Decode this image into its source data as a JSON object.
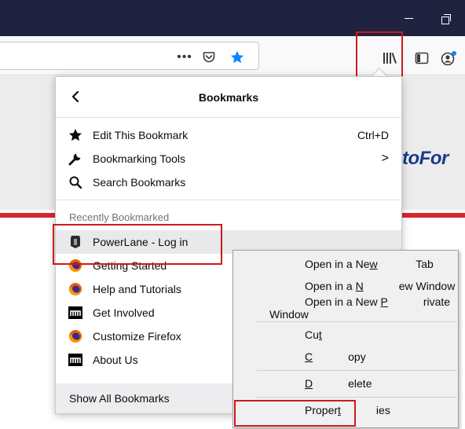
{
  "toolbar": {
    "page_actions_icon": "meatball-menu-icon",
    "page_actions_glyph": "•••",
    "pocket_icon": "pocket-icon",
    "bookmark_star_icon": "bookmark-star-icon",
    "library_icon": "library-icon",
    "sidebar_icon": "sidebar-icon",
    "account_icon": "account-icon"
  },
  "page": {
    "logo_text": "toFor"
  },
  "panel": {
    "title": "Bookmarks",
    "back_glyph": "‹",
    "items": [
      {
        "label": "Edit This Bookmark",
        "shortcut": "Ctrl+D",
        "icon": "star-icon"
      },
      {
        "label": "Bookmarking Tools",
        "shortcut": ">",
        "icon": "wrench-icon"
      },
      {
        "label": "Search Bookmarks",
        "shortcut": "",
        "icon": "search-icon"
      }
    ],
    "section_label": "Recently Bookmarked",
    "recent": [
      {
        "label": "PowerLane - Log in",
        "icon": "powerlane-favicon"
      },
      {
        "label": "Getting Started",
        "icon": "firefox-icon"
      },
      {
        "label": "Help and Tutorials",
        "icon": "firefox-icon"
      },
      {
        "label": "Get Involved",
        "icon": "mozilla-icon"
      },
      {
        "label": "Customize Firefox",
        "icon": "firefox-icon"
      },
      {
        "label": "About Us",
        "icon": "mozilla-icon"
      }
    ],
    "footer_label": "Show All Bookmarks"
  },
  "context_menu": {
    "open_new_tab": {
      "pre": "Open in a Ne",
      "key": "w",
      "post": " Tab"
    },
    "open_new_window": {
      "pre": "Open in a ",
      "key": "N",
      "post": "ew Window"
    },
    "open_private": {
      "pre": "Open in a New ",
      "key": "P",
      "post": "rivate Window"
    },
    "cut": {
      "pre": "Cu",
      "key": "t",
      "post": ""
    },
    "copy": {
      "pre": "",
      "key": "C",
      "post": "opy"
    },
    "delete": {
      "pre": "",
      "key": "D",
      "post": "elete"
    },
    "properties": {
      "pre": "Proper",
      "key": "t",
      "post": "ies"
    }
  },
  "colors": {
    "titlebar": "#202340",
    "accent_blue": "#0a84ff",
    "highlight_red": "#cc1a1a",
    "page_red": "#d8262f"
  }
}
